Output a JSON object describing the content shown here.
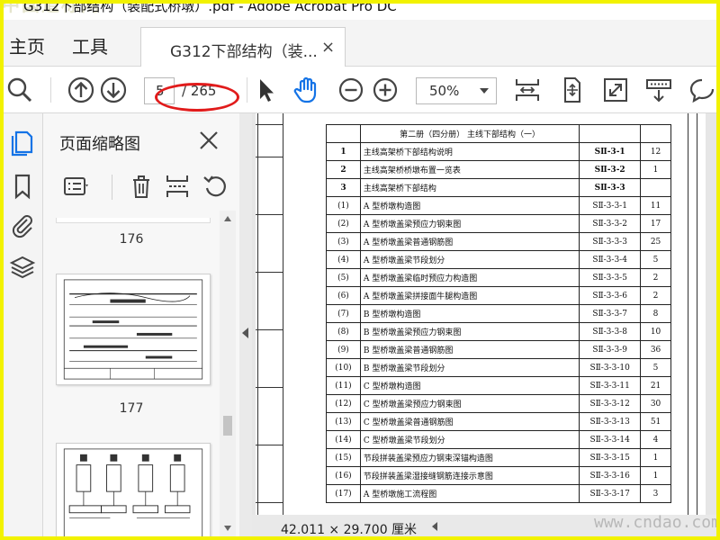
{
  "window": {
    "title": "G312下部结构（装配式桥墩）.pdf - Adobe Acrobat Pro DC"
  },
  "watermarks": {
    "top_left": "中国道标网",
    "bottom_right": "www.cndao.com"
  },
  "tabs": {
    "home": "主页",
    "tools": "工具",
    "document": "G312下部结构（装...",
    "close_symbol": "×"
  },
  "toolbar": {
    "page_current": "5",
    "page_total": "/ 265",
    "zoom": "50%",
    "icons": [
      "search-icon",
      "page-up-icon",
      "page-down-icon",
      "select-cursor-icon",
      "hand-tool-icon",
      "zoom-out-icon",
      "zoom-in-icon",
      "zoom-dropdown",
      "scroll-mode-icon",
      "fit-page-icon",
      "fullscreen-icon",
      "reading-mode-icon",
      "comment-icon"
    ],
    "annotation_color": "#e11b1b"
  },
  "rail": {
    "icons": [
      "page-thumbnails-icon",
      "bookmarks-icon",
      "attachments-icon",
      "layers-icon"
    ],
    "accent": "#1473e6"
  },
  "panel": {
    "title": "页面缩略图",
    "thumbnails": [
      {
        "number": "176"
      },
      {
        "number": "177"
      }
    ]
  },
  "document": {
    "status_dimensions": "42.011 × 29.700 厘米",
    "toc": {
      "heading": "第二册（四分册）  主线下部结构（一）",
      "rows": [
        {
          "no": "1",
          "name": "主线高架桥下部结构说明",
          "code": "SⅡ-3-1",
          "pages": "12",
          "bold": true
        },
        {
          "no": "2",
          "name": "主线高架桥桥墩布置一览表",
          "code": "SⅡ-3-2",
          "pages": "1",
          "bold": true
        },
        {
          "no": "3",
          "name": "主线高架桥下部结构",
          "code": "SⅡ-3-3",
          "pages": "",
          "bold": true
        },
        {
          "no": "(1)",
          "name": "A 型桥墩构造图",
          "code": "SⅡ-3-3-1",
          "pages": "11",
          "bold": false
        },
        {
          "no": "(2)",
          "name": "A 型桥墩盖梁预应力钢束图",
          "code": "SⅡ-3-3-2",
          "pages": "17",
          "bold": false
        },
        {
          "no": "(3)",
          "name": "A 型桥墩盖梁普通钢筋图",
          "code": "SⅡ-3-3-3",
          "pages": "25",
          "bold": false
        },
        {
          "no": "(4)",
          "name": "A 型桥墩盖梁节段划分",
          "code": "SⅡ-3-3-4",
          "pages": "5",
          "bold": false
        },
        {
          "no": "(5)",
          "name": "A 型桥墩盖梁临时预应力构造图",
          "code": "SⅡ-3-3-5",
          "pages": "2",
          "bold": false
        },
        {
          "no": "(6)",
          "name": "A 型桥墩盖梁拼接面牛腿构造图",
          "code": "SⅡ-3-3-6",
          "pages": "2",
          "bold": false
        },
        {
          "no": "(7)",
          "name": "B 型桥墩构造图",
          "code": "SⅡ-3-3-7",
          "pages": "8",
          "bold": false
        },
        {
          "no": "(8)",
          "name": "B 型桥墩盖梁预应力钢束图",
          "code": "SⅡ-3-3-8",
          "pages": "10",
          "bold": false
        },
        {
          "no": "(9)",
          "name": "B 型桥墩盖梁普通钢筋图",
          "code": "SⅡ-3-3-9",
          "pages": "36",
          "bold": false
        },
        {
          "no": "(10)",
          "name": "B 型桥墩盖梁节段划分",
          "code": "SⅡ-3-3-10",
          "pages": "5",
          "bold": false
        },
        {
          "no": "(11)",
          "name": "C 型桥墩构造图",
          "code": "SⅡ-3-3-11",
          "pages": "21",
          "bold": false
        },
        {
          "no": "(12)",
          "name": "C 型桥墩盖梁预应力钢束图",
          "code": "SⅡ-3-3-12",
          "pages": "30",
          "bold": false
        },
        {
          "no": "(13)",
          "name": "C 型桥墩盖梁普通钢筋图",
          "code": "SⅡ-3-3-13",
          "pages": "51",
          "bold": false
        },
        {
          "no": "(14)",
          "name": "C 型桥墩盖梁节段划分",
          "code": "SⅡ-3-3-14",
          "pages": "4",
          "bold": false
        },
        {
          "no": "(15)",
          "name": "节段拼装盖梁预应力钢束深锚构造图",
          "code": "SⅡ-3-3-15",
          "pages": "1",
          "bold": false
        },
        {
          "no": "(16)",
          "name": "节段拼装盖梁湿接缝钢筋连接示意图",
          "code": "SⅡ-3-3-16",
          "pages": "1",
          "bold": false
        },
        {
          "no": "(17)",
          "name": "A 型桥墩施工流程图",
          "code": "SⅡ-3-3-17",
          "pages": "3",
          "bold": false
        }
      ]
    }
  }
}
